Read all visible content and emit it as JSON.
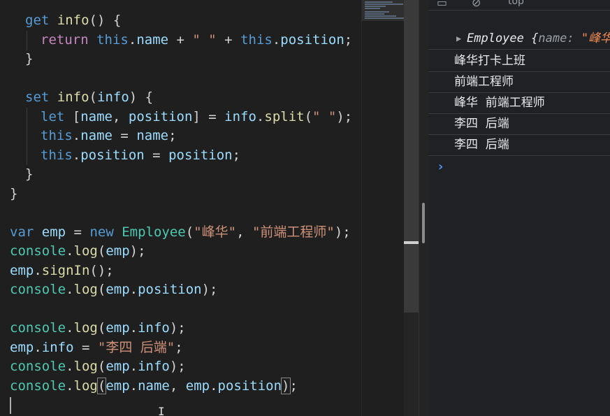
{
  "editor": {
    "lines": [
      "get info() {",
      "return this.name + \" \" + this.position;",
      "}",
      "",
      "set info(info) {",
      "let [name, position] = info.split(\" \");",
      "this.name = name;",
      "this.position = position;",
      "}",
      "}",
      "",
      "var emp = new Employee(\"峰华\", \"前端工程师\");",
      "console.log(emp);",
      "emp.signIn();",
      "console.log(emp.position);",
      "",
      "console.log(emp.info);",
      "emp.info = \"李四 后端\";",
      "console.log(emp.info);",
      "console.log(emp.name, emp.position);"
    ]
  },
  "devtools": {
    "toolbar_context": "top",
    "console": [
      {
        "type": "object",
        "class_name": "Employee",
        "preview_key": "name",
        "preview_val": "\"峰华"
      },
      {
        "type": "text",
        "value": "峰华打卡上班"
      },
      {
        "type": "text",
        "value": "前端工程师"
      },
      {
        "type": "text",
        "value": "峰华  前端工程师"
      },
      {
        "type": "text",
        "value": "李四  后端"
      },
      {
        "type": "text",
        "value": "李四  后端"
      }
    ],
    "prompt_symbol": "›"
  },
  "colors": {
    "keyword": "#569cd6",
    "control_keyword": "#c586c0",
    "function": "#dcdcaa",
    "variable": "#9cdcfe",
    "string": "#ce9178",
    "class": "#4ec9b0",
    "console_prompt": "#4d8ff0"
  }
}
